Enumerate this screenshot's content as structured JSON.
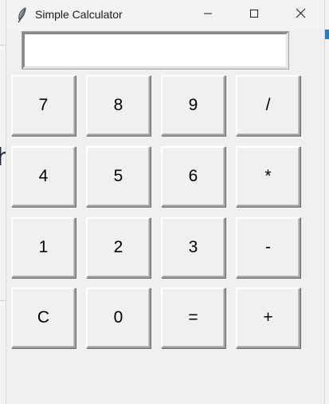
{
  "window": {
    "title": "Simple Calculator"
  },
  "display": {
    "value": ""
  },
  "keys": {
    "row1": [
      "7",
      "8",
      "9",
      "/"
    ],
    "row2": [
      "4",
      "5",
      "6",
      "*"
    ],
    "row3": [
      "1",
      "2",
      "3",
      "-"
    ],
    "row4": [
      "C",
      "0",
      "=",
      "+"
    ]
  },
  "background": {
    "left_glyph": "h"
  },
  "icons": {
    "app": "feather-icon",
    "minimize": "minimize-icon",
    "maximize": "maximize-icon",
    "close": "close-icon"
  }
}
